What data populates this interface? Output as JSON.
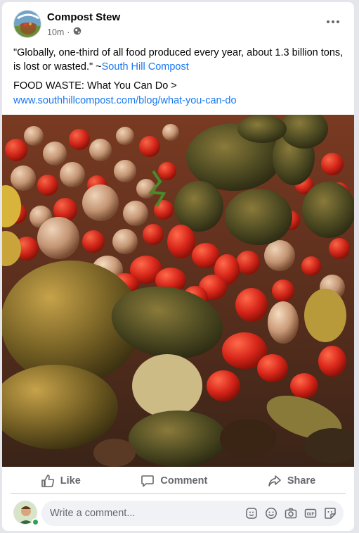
{
  "post": {
    "page_name": "Compost Stew",
    "time": "10m",
    "separator": "·",
    "privacy_icon": "globe-icon",
    "quote_text": "\"Globally, one-third of all food produced every year, about 1.3 billion tons, is lost or wasted.\" ~",
    "source_link": "South Hill Compost",
    "headline": "FOOD WASTE: What You Can Do >",
    "url": "www.southhillcompost.com/blog/what-you-can-do",
    "photo_description_icon": "food-waste-photo",
    "avatar_text": "Compost Stew"
  },
  "actions": {
    "like_label": "Like",
    "comment_label": "Comment",
    "share_label": "Share"
  },
  "comment": {
    "placeholder": "Write a comment..."
  },
  "colors": {
    "link": "#1877f2",
    "secondary_text": "#65676b",
    "online": "#31a24c",
    "comment_bg": "#f0f2f5"
  }
}
